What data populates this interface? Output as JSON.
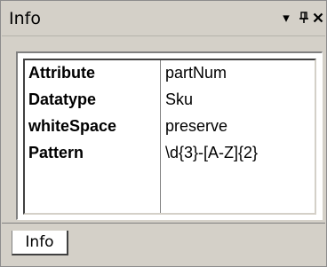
{
  "window": {
    "title": "Info",
    "dropdown_icon": "triangle-down",
    "pin_icon": "pin",
    "close_icon": "close"
  },
  "properties": [
    {
      "name": "Attribute",
      "value": "partNum"
    },
    {
      "name": "Datatype",
      "value": "Sku"
    },
    {
      "name": "whiteSpace",
      "value": "preserve"
    },
    {
      "name": "Pattern",
      "value": "\\d{3}-[A-Z]{2}"
    }
  ],
  "tabs": [
    {
      "label": "Info",
      "active": true
    }
  ]
}
